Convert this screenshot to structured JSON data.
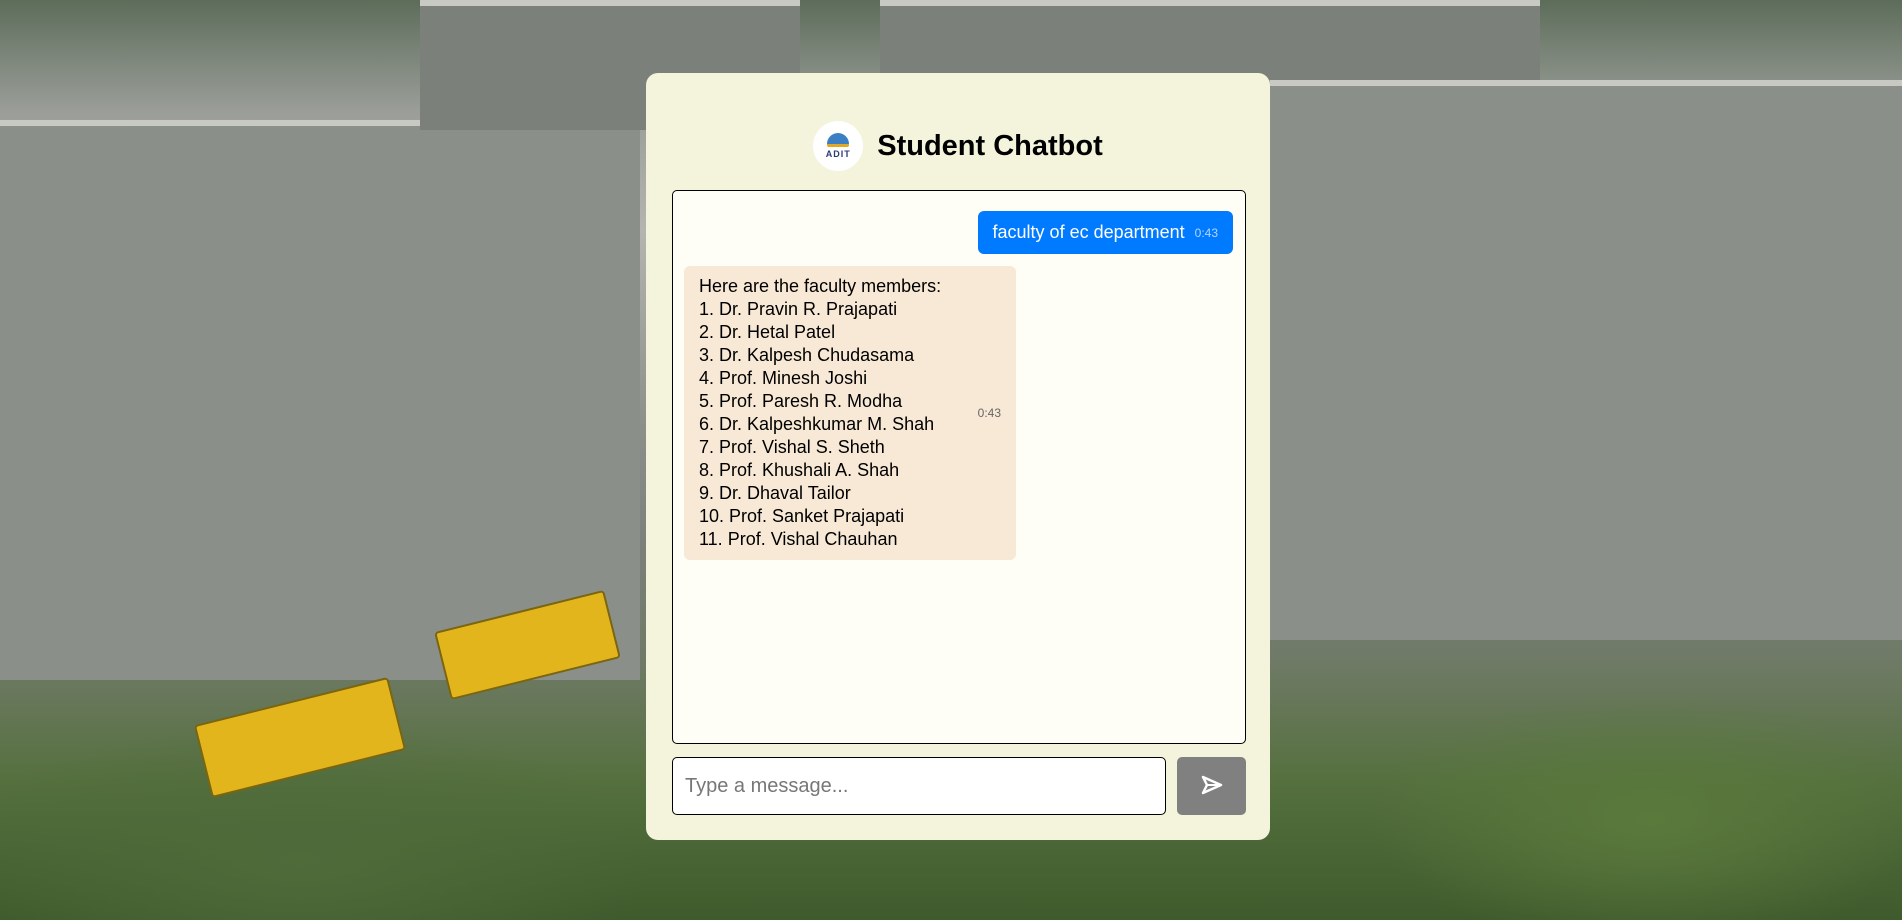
{
  "header": {
    "title": "Student Chatbot",
    "logo_text": "ADIT"
  },
  "messages": [
    {
      "sender": "user",
      "text": "faculty of ec department",
      "time": "0:43"
    },
    {
      "sender": "bot",
      "lines": [
        "Here are the faculty members:",
        "1. Dr. Pravin R. Prajapati",
        "2. Dr. Hetal Patel",
        "3. Dr. Kalpesh Chudasama",
        "4. Prof. Minesh Joshi",
        "5. Prof. Paresh R. Modha",
        "6. Dr. Kalpeshkumar M. Shah",
        "7. Prof. Vishal S. Sheth",
        "8. Prof. Khushali A. Shah",
        "9. Dr. Dhaval Tailor",
        "10. Prof. Sanket Prajapati",
        "11. Prof. Vishal Chauhan"
      ],
      "time": "0:43"
    }
  ],
  "input": {
    "placeholder": "Type a message...",
    "value": ""
  },
  "send": {
    "icon": "send-icon"
  },
  "colors": {
    "user_bubble": "#007bff",
    "bot_bubble": "#f8e9d6",
    "card": "#f4f4dc"
  }
}
